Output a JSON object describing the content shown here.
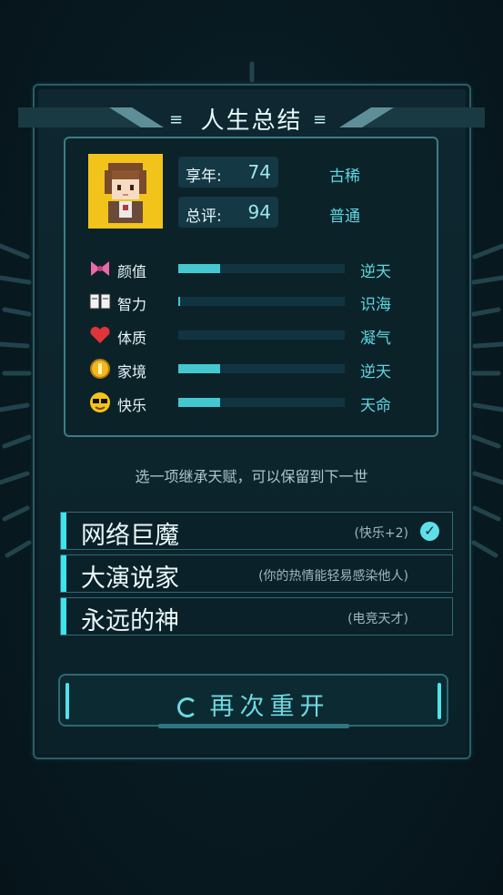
{
  "title": "人生总结",
  "summary": {
    "age_label": "享年:",
    "age_value": "74",
    "age_rank": "古稀",
    "score_label": "总评:",
    "score_value": "94",
    "score_rank": "普通"
  },
  "attributes": [
    {
      "name": "颜值",
      "icon": "bow-icon",
      "rank": "逆天",
      "level": 0.25
    },
    {
      "name": "智力",
      "icon": "book-icon",
      "rank": "识海",
      "level": 0.01
    },
    {
      "name": "体质",
      "icon": "heart-icon",
      "rank": "凝气",
      "level": 0.0
    },
    {
      "name": "家境",
      "icon": "coin-icon",
      "rank": "逆天",
      "level": 0.25
    },
    {
      "name": "快乐",
      "icon": "sunglasses-face-icon",
      "rank": "天命",
      "level": 0.25
    }
  ],
  "hint": "选一项继承天赋，可以保留到下一世",
  "talents": [
    {
      "name": "网络巨魔",
      "desc": "(快乐+2)",
      "selected": true
    },
    {
      "name": "大演说家",
      "desc": "(你的热情能轻易感染他人)",
      "selected": false
    },
    {
      "name": "永远的神",
      "desc": "(电竞天才)",
      "selected": false
    }
  ],
  "restart_label": "再次重开",
  "colors": {
    "accent": "#44c7cf",
    "avatar_bg": "#f2c31b",
    "rank_text": "#5fd6e0"
  }
}
